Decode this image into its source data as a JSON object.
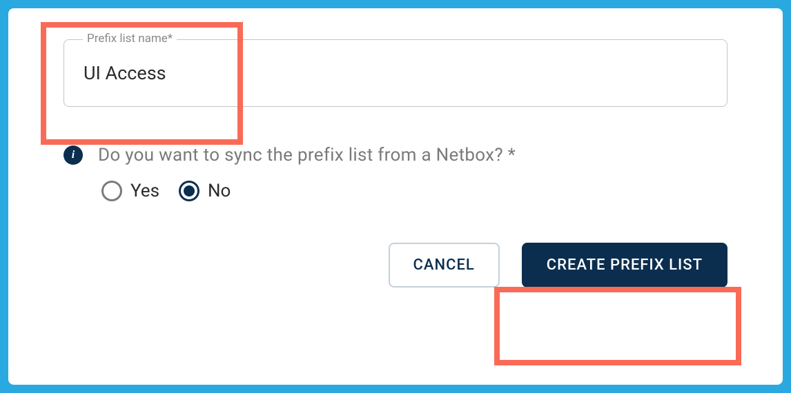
{
  "field": {
    "label": "Prefix list name*",
    "value": "UI Access"
  },
  "question": {
    "text": "Do you want to sync the prefix list from a Netbox?   *"
  },
  "radios": {
    "yes": "Yes",
    "no": "No",
    "selected": "no"
  },
  "buttons": {
    "cancel": "CANCEL",
    "create": "CREATE PREFIX LIST"
  }
}
